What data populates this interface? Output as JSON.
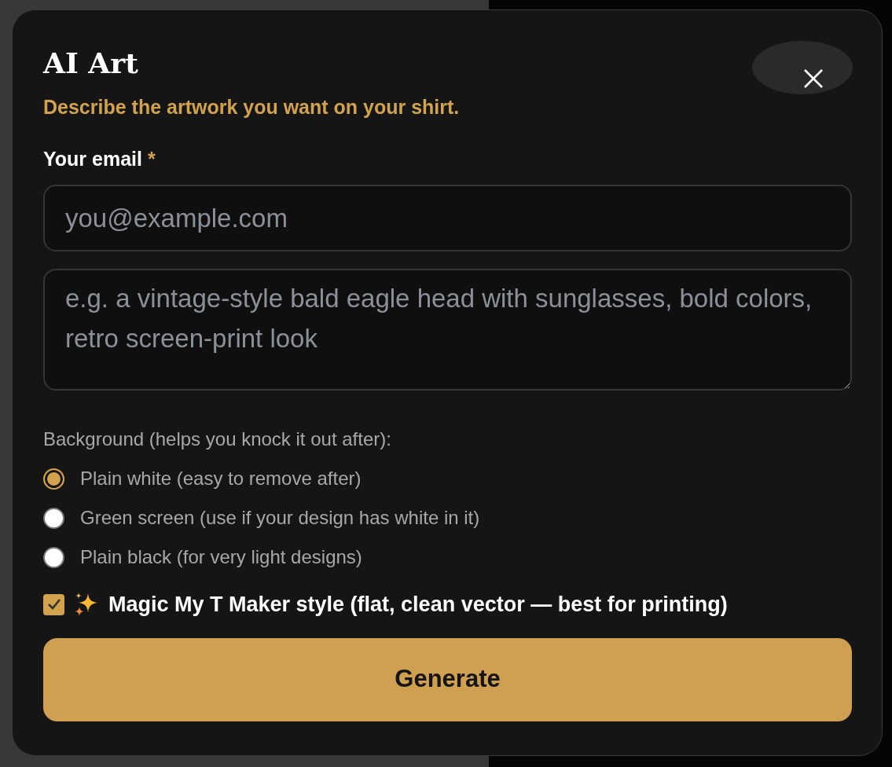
{
  "modal": {
    "title": "AI Art",
    "subtitle": "Describe the artwork you want on your shirt.",
    "email": {
      "label": "Your email",
      "required_mark": "*",
      "placeholder": "you@example.com"
    },
    "description": {
      "placeholder": "e.g. a vintage-style bald eagle head with sunglasses, bold colors, retro screen-print look"
    },
    "background": {
      "label": "Background (helps you knock it out after):",
      "options": [
        {
          "label": "Plain white (easy to remove after)",
          "selected": true
        },
        {
          "label": "Green screen (use if your design has white in it)",
          "selected": false
        },
        {
          "label": "Plain black (for very light designs)",
          "selected": false
        }
      ]
    },
    "magic_style": {
      "label": "Magic My T Maker style (flat, clean vector — best for printing)",
      "checked": true
    },
    "generate_button": "Generate"
  }
}
